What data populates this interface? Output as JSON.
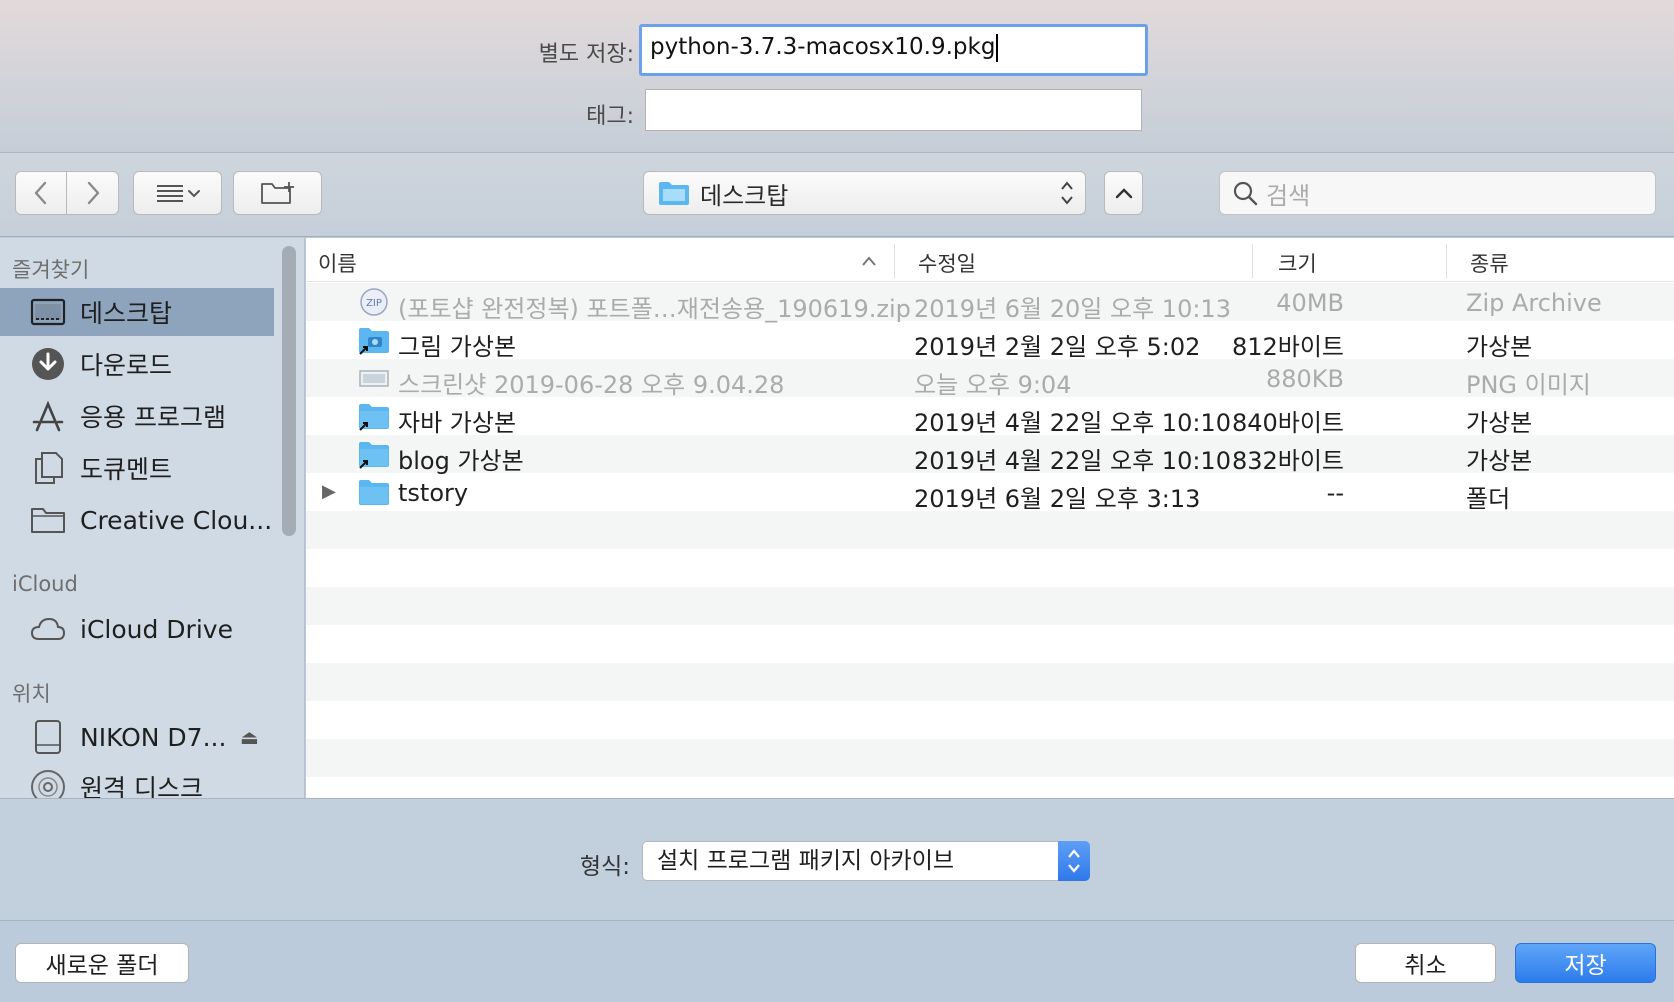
{
  "save": {
    "save_as_label": "별도 저장:",
    "filename": "python-3.7.3-macosx10.9.pkg",
    "tags_label": "태그:",
    "tags_value": ""
  },
  "toolbar": {
    "location": "데스크탑",
    "search_placeholder": "검색"
  },
  "sidebar": {
    "favorites_title": "즐겨찾기",
    "favorites": [
      {
        "label": "데스크탑",
        "icon": "desktop-icon",
        "selected": true
      },
      {
        "label": "다운로드",
        "icon": "download-icon"
      },
      {
        "label": "응용 프로그램",
        "icon": "applications-icon"
      },
      {
        "label": "도큐멘트",
        "icon": "documents-icon"
      },
      {
        "label": "Creative Clou...",
        "icon": "folder-icon"
      }
    ],
    "icloud_title": "iCloud",
    "icloud": [
      {
        "label": "iCloud Drive",
        "icon": "cloud-icon"
      }
    ],
    "locations_title": "위치",
    "locations": [
      {
        "label": "NIKON D7...",
        "icon": "drive-icon"
      },
      {
        "label": "원격 디스크",
        "icon": "disc-icon"
      }
    ]
  },
  "columns": {
    "name": "이름",
    "modified": "수정일",
    "size": "크기",
    "kind": "종류"
  },
  "files": [
    {
      "name": "(포토샵 완전정복) 포트폴…재전송용_190619.zip",
      "modified": "2019년 6월 20일 오후 10:13",
      "size": "40MB",
      "kind": "Zip Archive",
      "icon": "zip-icon",
      "dimmed": true
    },
    {
      "name": "그림 가상본",
      "modified": "2019년 2월 2일 오후 5:02",
      "size": "812바이트",
      "kind": "가상본",
      "icon": "pictures-alias-icon",
      "dimmed": false
    },
    {
      "name": "스크린샷 2019-06-28 오후 9.04.28",
      "modified": "오늘 오후 9:04",
      "size": "880KB",
      "kind": "PNG 이미지",
      "icon": "image-file-icon",
      "dimmed": true
    },
    {
      "name": "자바 가상본",
      "modified": "2019년 4월 22일 오후 10:10",
      "size": "840바이트",
      "kind": "가상본",
      "icon": "folder-alias-icon",
      "dimmed": false
    },
    {
      "name": "blog 가상본",
      "modified": "2019년 4월 22일 오후 10:10",
      "size": "832바이트",
      "kind": "가상본",
      "icon": "folder-alias-icon",
      "dimmed": false
    },
    {
      "name": "tstory",
      "modified": "2019년 6월 2일 오후 3:13",
      "size": "--",
      "kind": "폴더",
      "icon": "folder-icon",
      "dimmed": false
    }
  ],
  "format": {
    "label": "형식:",
    "value": "설치 프로그램 패키지 아카이브"
  },
  "buttons": {
    "new_folder": "새로운 폴더",
    "cancel": "취소",
    "save": "저장"
  },
  "colors": {
    "accent": "#2f7bec",
    "selection": "#8ea4bd",
    "folder": "#5cb6ef"
  }
}
